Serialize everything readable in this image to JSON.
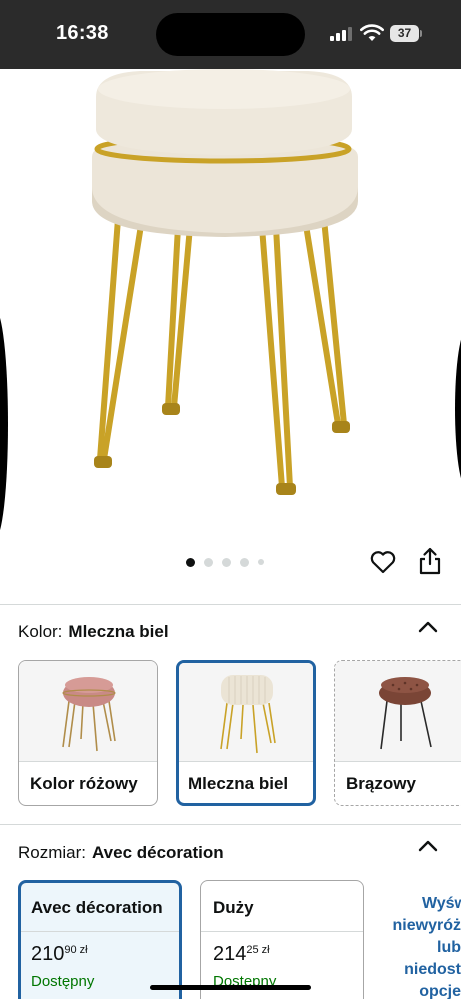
{
  "status_bar": {
    "time": "16:38",
    "battery": "37"
  },
  "carousel": {
    "total_dots": 5,
    "active_index": 0
  },
  "color_section": {
    "label": "Kolor:",
    "selected_value": "Mleczna biel",
    "options": [
      {
        "label": "Kolor różowy"
      },
      {
        "label": "Mleczna biel"
      },
      {
        "label": "Brązowy"
      }
    ]
  },
  "size_section": {
    "label": "Rozmiar:",
    "selected_value": "Avec décoration",
    "options": [
      {
        "title": "Avec décoration",
        "price_main": "210",
        "price_cents": "90",
        "currency": "zł",
        "availability": "Dostępny"
      },
      {
        "title": "Duży",
        "price_main": "214",
        "price_cents": "25",
        "currency": "zł",
        "availability": "Dostępny"
      }
    ],
    "more_options_lines": [
      "Wyśw",
      "niewyróż",
      "lub",
      "niedost",
      "opcje"
    ]
  },
  "colors": {
    "accent": "#2162a1",
    "in_stock": "#007600",
    "gold": "#c9a227",
    "cream": "#ece5d8"
  }
}
